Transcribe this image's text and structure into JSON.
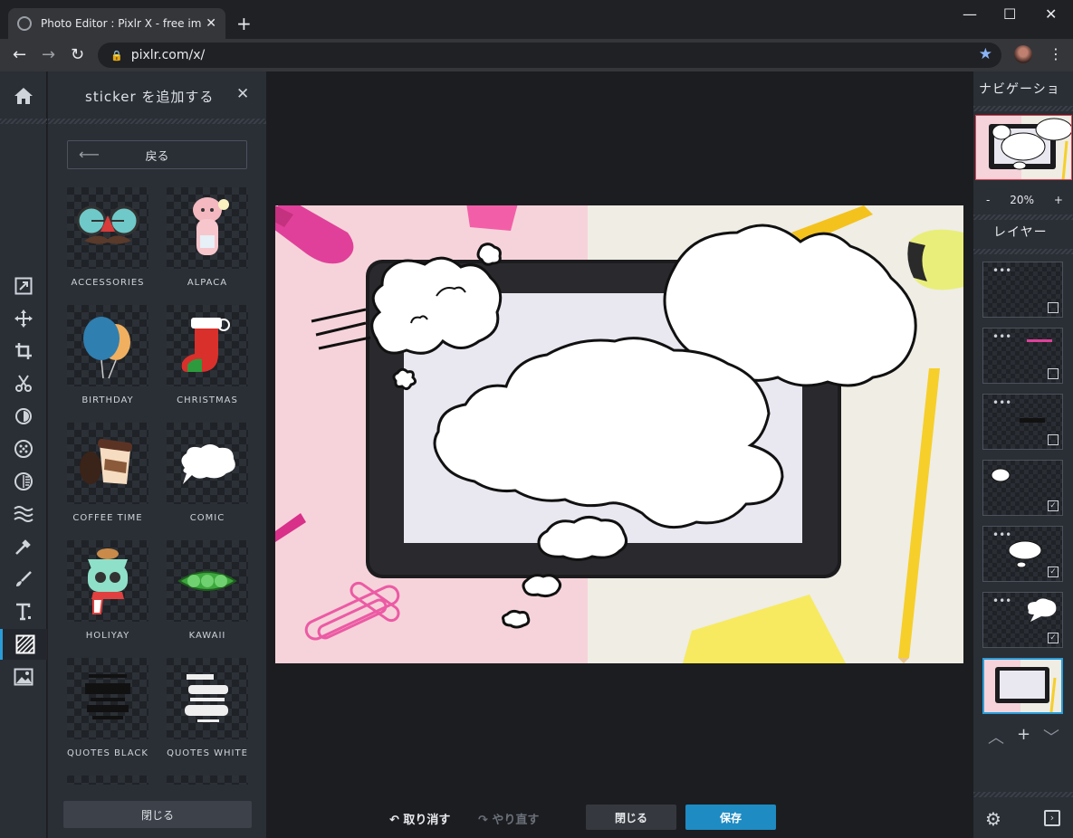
{
  "browser": {
    "tab_title": "Photo Editor : Pixlr X - free image",
    "tab_close": "✕",
    "new_tab": "+",
    "url": "pixlr.com/x/",
    "window": {
      "minimize": "—",
      "maximize": "☐",
      "close": "✕"
    }
  },
  "toolbar": {
    "tools": [
      {
        "name": "home-icon"
      },
      {
        "name": "arrange-icon"
      },
      {
        "name": "move-icon"
      },
      {
        "name": "crop-icon"
      },
      {
        "name": "cutout-icon"
      },
      {
        "name": "adjust-icon"
      },
      {
        "name": "filter-icon"
      },
      {
        "name": "effect-icon"
      },
      {
        "name": "liquify-icon"
      },
      {
        "name": "retouch-icon"
      },
      {
        "name": "draw-icon"
      },
      {
        "name": "text-icon"
      },
      {
        "name": "elements-icon"
      },
      {
        "name": "add-image-icon"
      }
    ],
    "active_tool": "elements-icon"
  },
  "sticker_panel": {
    "title": "sticker を追加する",
    "close": "✕",
    "back_label": "戻る",
    "close_label": "閉じる",
    "stickers": [
      {
        "label": "ACCESSORIES"
      },
      {
        "label": "ALPACA"
      },
      {
        "label": "BIRTHDAY"
      },
      {
        "label": "CHRISTMAS"
      },
      {
        "label": "COFFEE TIME"
      },
      {
        "label": "COMIC"
      },
      {
        "label": "HOLIYAY"
      },
      {
        "label": "KAWAII"
      },
      {
        "label": "QUOTES BLACK"
      },
      {
        "label": "QUOTES WHITE"
      }
    ]
  },
  "bottom": {
    "undo_label": "取り消す",
    "redo_label": "やり直す",
    "close_label": "閉じる",
    "save_label": "保存"
  },
  "right_panel": {
    "navigation_title": "ナビゲーショ",
    "zoom_minus": "-",
    "zoom_value": "20%",
    "zoom_plus": "+",
    "layers_title": "レイヤー",
    "layer_checks": [
      "",
      "",
      "",
      "✓",
      "✓",
      "✓",
      ""
    ]
  },
  "colors": {
    "accent": "#2a9dd8",
    "save_button": "#1e8bc3",
    "panel_bg": "#2a2e35",
    "workspace_bg": "#1c1d21"
  }
}
